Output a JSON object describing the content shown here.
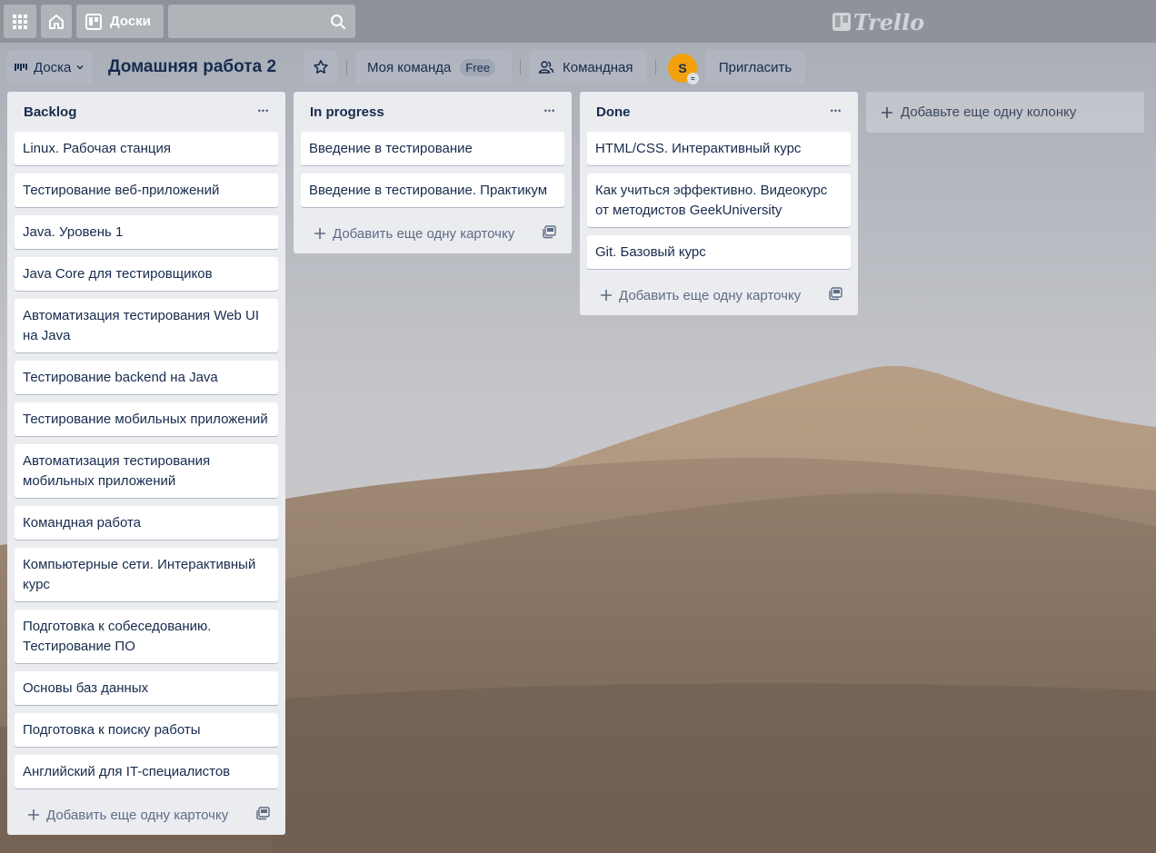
{
  "header": {
    "boards_label": "Доски",
    "logo_text": "Trello"
  },
  "board": {
    "view_label": "Доска",
    "title": "Домашняя работа 2",
    "team_label": "Моя команда",
    "team_badge": "Free",
    "visibility_label": "Командная",
    "avatar_initial": "S",
    "invite_label": "Пригласить"
  },
  "lists": [
    {
      "title": "Backlog",
      "cards": [
        "Linux. Рабочая станция",
        "Тестирование веб-приложений",
        "Java. Уровень 1",
        "Java Core для тестировщиков",
        "Автоматизация тестирования Web UI на Java",
        "Тестирование backend на Java",
        "Тестирование мобильных приложений",
        "Автоматизация тестирования мобильных приложений",
        "Командная работа",
        "Компьютерные сети. Интерактивный курс",
        "Подготовка к собеседованию. Тестирование ПО",
        "Основы баз данных",
        "Подготовка к поиску работы",
        "Английский для IT-специалистов"
      ],
      "add_card_label": "Добавить еще одну карточку"
    },
    {
      "title": "In progress",
      "cards": [
        "Введение в тестирование",
        "Введение в тестирование. Практикум"
      ],
      "add_card_label": "Добавить еще одну карточку"
    },
    {
      "title": "Done",
      "cards": [
        "HTML/CSS. Интерактивный курс",
        "Как учиться эффективно. Видеокурс от методистов GeekUniversity",
        "Git. Базовый курс"
      ],
      "add_card_label": "Добавить еще одну карточку"
    }
  ],
  "add_list_label": "Добавьте еще одну колонку",
  "colors": {
    "list_bg": "#ebecf0",
    "text": "#172b4d",
    "avatar": "#f2a00c"
  }
}
